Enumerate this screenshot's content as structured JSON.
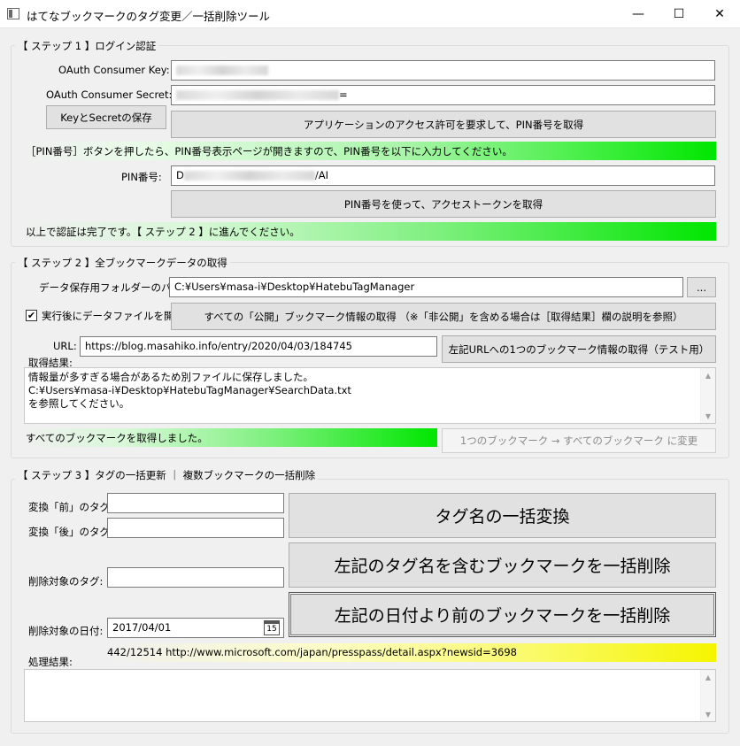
{
  "window": {
    "title": "はてなブックマークのタグ変更／一括削除ツール",
    "minimize": "—",
    "maximize": "☐",
    "close": "✕"
  },
  "step1": {
    "legend": "【 ステップ 1 】ログイン認証",
    "consumer_key_label": "OAuth Consumer Key:",
    "consumer_secret_label": "OAuth Consumer Secret:",
    "consumer_secret_suffix": "=",
    "save_button": "KeyとSecretの保存",
    "request_pin_button": "アプリケーションのアクセス許可を要求して、PIN番号を取得",
    "pin_instruction": "［PIN番号］ボタンを押したら、PIN番号表示ページが開きますので、PIN番号を以下に入力してください。",
    "pin_label": "PIN番号:",
    "pin_prefix": "D",
    "pin_suffix": "/AI",
    "access_token_button": "PIN番号を使って、アクセストークンを取得",
    "done_message": "以上で認証は完了です。【 ステップ 2 】に進んでください。"
  },
  "step2": {
    "legend": "【 ステップ 2 】全ブックマークデータの取得",
    "folder_label": "データ保存用フォルダーのパス:",
    "folder_value": "C:¥Users¥masa-i¥Desktop¥HatebuTagManager",
    "browse_button": "...",
    "open_after_label": "実行後にデータファイルを開く",
    "open_after_check": "✔",
    "fetch_all_button": "すべての「公開」ブックマーク情報の取得 （※「非公開」を含める場合は［取得結果］欄の説明を参照）",
    "url_label": "URL:",
    "url_value": "https://blog.masahiko.info/entry/2020/04/03/184745",
    "fetch_one_button": "左記URLへの1つのブックマーク情報の取得（テスト用）",
    "result_label": "取得結果:",
    "result_lines": [
      "情報量が多すぎる場合があるため別ファイルに保存しました。",
      "C:¥Users¥masa-i¥Desktop¥HatebuTagManager¥SearchData.txt",
      "を参照してください。"
    ],
    "status": "すべてのブックマークを取得しました。",
    "switch_button": "1つのブックマーク → すべてのブックマーク に変更"
  },
  "step3": {
    "legend": "【 ステップ 3 】タグの一括更新 ｜ 複数ブックマークの一括削除",
    "before_tag_label": "変換「前」のタグ:",
    "before_tag_value": "",
    "after_tag_label": "変換「後」のタグ:",
    "after_tag_value": "",
    "convert_button": "タグ名の一括変換",
    "delete_tag_label": "削除対象のタグ:",
    "delete_tag_value": "",
    "delete_by_tag_button": "左記のタグ名を含むブックマークを一括削除",
    "date_label": "削除対象の日付:",
    "date_value": "2017/04/01",
    "calendar_day": "15",
    "delete_by_date_button": "左記の日付より前のブックマークを一括削除",
    "progress_text": "442/12514 http://www.microsoft.com/japan/presspass/detail.aspx?newsid=3698",
    "process_result_label": "処理結果:"
  }
}
